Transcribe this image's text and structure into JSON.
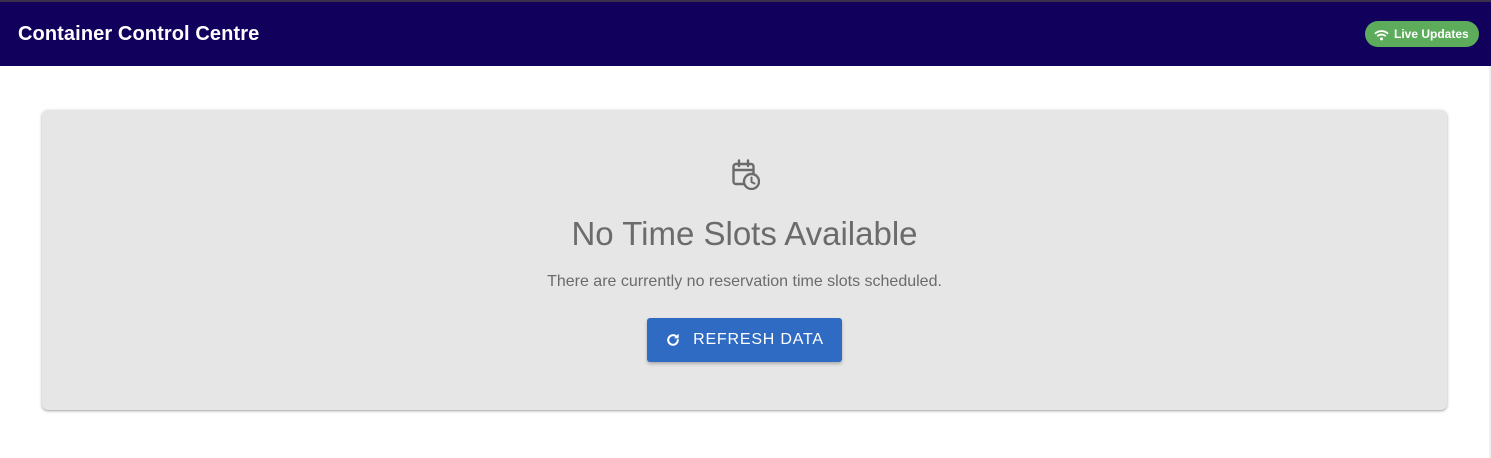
{
  "header": {
    "title": "Container Control Centre",
    "live_chip": {
      "label": "Live Updates",
      "icon": "wifi-icon",
      "color": "#5cac5c"
    },
    "background": "#11005c"
  },
  "empty_state": {
    "icon": "calendar-clock-icon",
    "title": "No Time Slots Available",
    "description": "There are currently no reservation time slots scheduled.",
    "button": {
      "label": "REFRESH DATA",
      "icon": "refresh-icon",
      "color": "#2f6ac3"
    }
  }
}
